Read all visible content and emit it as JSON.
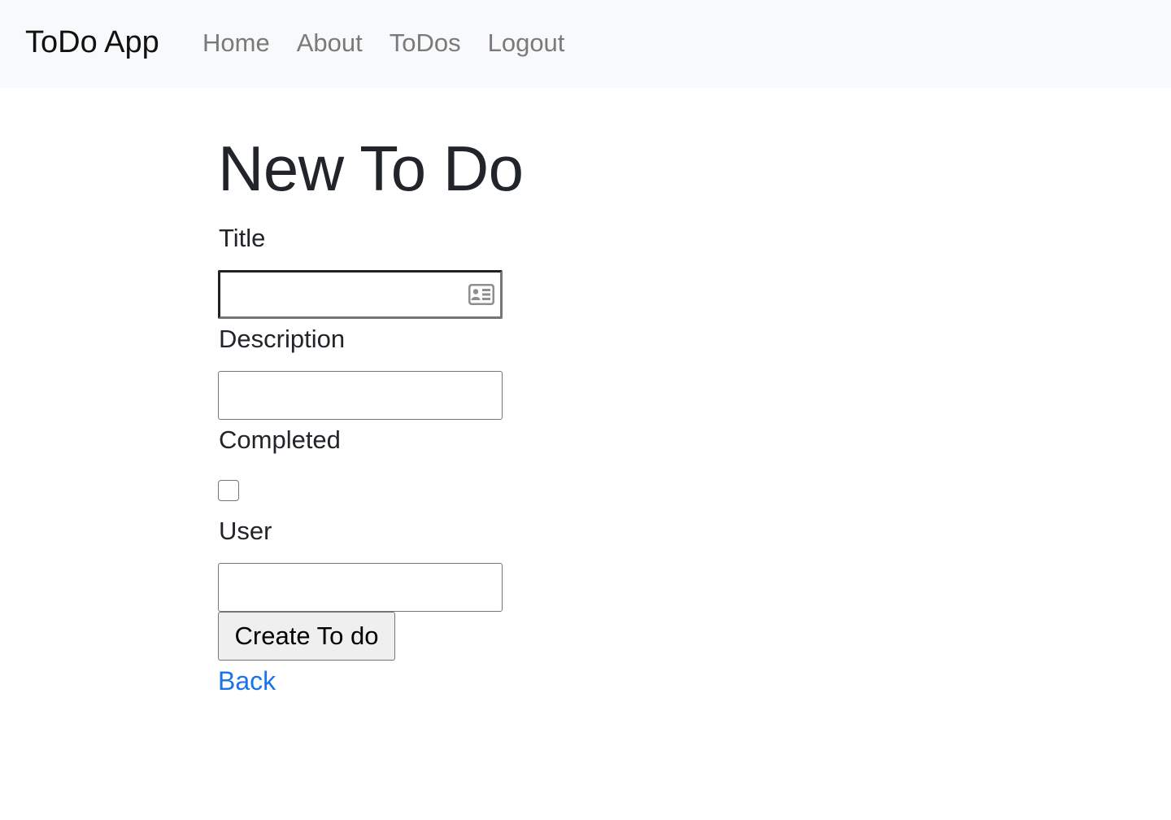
{
  "navbar": {
    "brand": "ToDo App",
    "links": [
      {
        "label": "Home"
      },
      {
        "label": "About"
      },
      {
        "label": "ToDos"
      },
      {
        "label": "Logout"
      }
    ]
  },
  "page": {
    "title": "New To Do"
  },
  "form": {
    "title_label": "Title",
    "title_value": "",
    "title_icon": "contact-card-icon",
    "description_label": "Description",
    "description_value": "",
    "completed_label": "Completed",
    "completed_checked": false,
    "user_label": "User",
    "user_value": "",
    "submit_label": "Create To do",
    "back_label": "Back"
  },
  "colors": {
    "navbar_bg": "#f8f9fa",
    "nav_link": "#7a7a7a",
    "text": "#212529",
    "link": "#1a73e8",
    "button_bg": "#efefef"
  }
}
